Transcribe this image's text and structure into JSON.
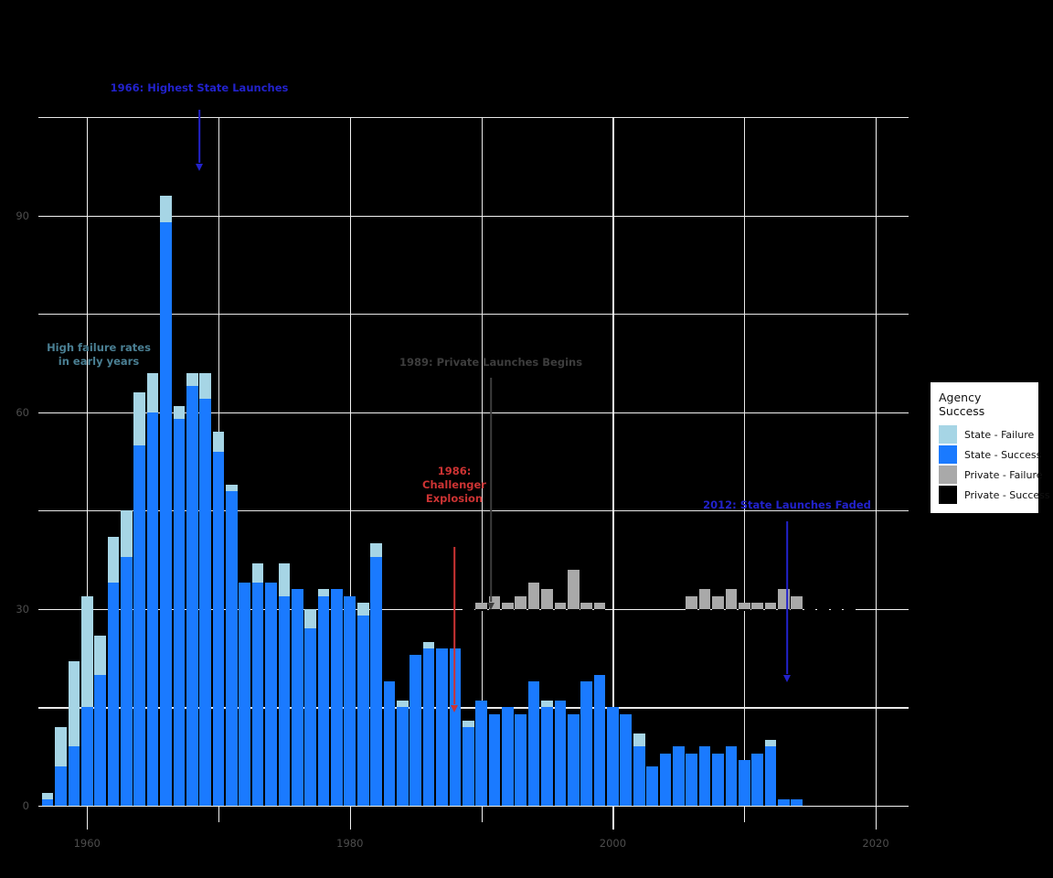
{
  "chart_data": {
    "type": "bar",
    "title": "",
    "subtitle": "",
    "xlabel": "",
    "ylabel": "",
    "stacked": true,
    "grid": true,
    "xlim": [
      1956.3,
      2022.5
    ],
    "ylim": [
      0,
      105
    ],
    "x_ticks": [
      1960,
      1980,
      2000,
      2020
    ],
    "x_minor_ticks": [
      1970,
      1990,
      2010
    ],
    "y_ticks": [
      0,
      30,
      60,
      90
    ],
    "y_minor_ticks": [
      15,
      45,
      75,
      105
    ],
    "legend": {
      "title": "Agency Success",
      "position": "right",
      "entries": [
        {
          "label": "State - Failure",
          "color": "#a6d5e5"
        },
        {
          "label": "State - Success",
          "color": "#1a7aff"
        },
        {
          "label": "Private - Failure",
          "color": "#a9a9a9"
        },
        {
          "label": "Private - Success",
          "color": "#000000"
        }
      ]
    },
    "series": [
      {
        "name": "State - Success",
        "color": "#1a7aff"
      },
      {
        "name": "State - Failure",
        "color": "#a6d5e5"
      },
      {
        "name": "Private - Success",
        "color": "#000000"
      },
      {
        "name": "Private - Failure",
        "color": "#a9a9a9"
      }
    ],
    "x": [
      1957,
      1958,
      1959,
      1960,
      1961,
      1962,
      1963,
      1964,
      1965,
      1966,
      1967,
      1968,
      1969,
      1970,
      1971,
      1972,
      1973,
      1974,
      1975,
      1976,
      1977,
      1978,
      1979,
      1980,
      1981,
      1982,
      1983,
      1984,
      1985,
      1986,
      1987,
      1988,
      1989,
      1990,
      1991,
      1992,
      1993,
      1994,
      1995,
      1996,
      1997,
      1998,
      1999,
      2000,
      2001,
      2002,
      2003,
      2004,
      2005,
      2006,
      2007,
      2008,
      2009,
      2010,
      2011,
      2012,
      2013,
      2014,
      2015,
      2016,
      2017,
      2018,
      2019,
      2020
    ],
    "state_success": [
      1,
      6,
      9,
      15,
      20,
      34,
      38,
      55,
      60,
      89,
      59,
      64,
      62,
      54,
      48,
      34,
      34,
      34,
      32,
      33,
      27,
      32,
      33,
      32,
      29,
      38,
      19,
      15,
      23,
      24,
      24,
      24,
      12,
      16,
      14,
      15,
      14,
      19,
      15,
      16,
      14,
      19,
      20,
      15,
      14,
      9,
      6,
      8,
      9,
      8,
      9,
      8,
      9,
      7,
      8,
      9,
      1,
      1,
      0,
      0,
      0,
      0,
      0,
      0
    ],
    "state_failure": [
      1,
      6,
      13,
      17,
      6,
      7,
      7,
      8,
      6,
      4,
      2,
      2,
      4,
      3,
      1,
      0,
      3,
      0,
      5,
      0,
      3,
      1,
      0,
      0,
      2,
      2,
      0,
      1,
      0,
      1,
      0,
      0,
      1,
      0,
      0,
      0,
      0,
      0,
      1,
      0,
      0,
      0,
      0,
      0,
      0,
      2,
      0,
      0,
      0,
      0,
      0,
      0,
      0,
      0,
      0,
      1,
      0,
      0,
      0,
      0,
      0,
      0,
      0,
      0
    ],
    "private_success": [
      0,
      0,
      0,
      0,
      0,
      0,
      0,
      0,
      0,
      0,
      0,
      0,
      0,
      0,
      0,
      0,
      0,
      0,
      0,
      0,
      0,
      0,
      0,
      0,
      0,
      0,
      0,
      0,
      0,
      0,
      0,
      0,
      30,
      30,
      30,
      30,
      30,
      30,
      30,
      30,
      30,
      30,
      30,
      0,
      0,
      0,
      0,
      0,
      0,
      30,
      30,
      30,
      30,
      30,
      30,
      30,
      30,
      30,
      30,
      30,
      30,
      30,
      0,
      0
    ],
    "private_failure": [
      0,
      0,
      0,
      0,
      0,
      0,
      0,
      0,
      0,
      0,
      0,
      0,
      0,
      0,
      0,
      0,
      0,
      0,
      0,
      0,
      0,
      0,
      0,
      0,
      0,
      0,
      0,
      0,
      0,
      0,
      0,
      0,
      0,
      1,
      2,
      1,
      2,
      4,
      3,
      1,
      6,
      1,
      1,
      0,
      0,
      0,
      0,
      0,
      0,
      2,
      3,
      2,
      3,
      1,
      1,
      1,
      3,
      2,
      0,
      0,
      0,
      0,
      0,
      0
    ],
    "private_offset_note": "Private bars are drawn as an overlay band centred near y=30"
  },
  "annotations": [
    {
      "id": "peak-state",
      "text": "1966: Highest State Launches",
      "color": "#2222cc",
      "arrow": true
    },
    {
      "id": "early-failures",
      "text": "High failure rates\nin early years",
      "color": "#4a7f93",
      "arrow": false
    },
    {
      "id": "private-begins",
      "text": "1989: Private Launches Begins",
      "color": "#3d3d3d",
      "arrow": true
    },
    {
      "id": "challenger",
      "text": "1986:\nChallenger\nExplosion",
      "color": "#cc3333",
      "arrow": true
    },
    {
      "id": "state-faded",
      "text": "2012: State Launches Faded",
      "color": "#2222cc",
      "arrow": true
    }
  ],
  "axis": {
    "x_tick_labels": [
      "1960",
      "1980",
      "2000",
      "2020"
    ],
    "y_tick_labels": [
      "0",
      "30",
      "60",
      "90"
    ]
  },
  "colors": {
    "background": "#000000",
    "gridline": "#f2f2f2",
    "tick_text": "#4d4d4d",
    "state_failure": "#a6d5e5",
    "state_success": "#1a7aff",
    "private_failure": "#a9a9a9",
    "private_success": "#000000"
  }
}
